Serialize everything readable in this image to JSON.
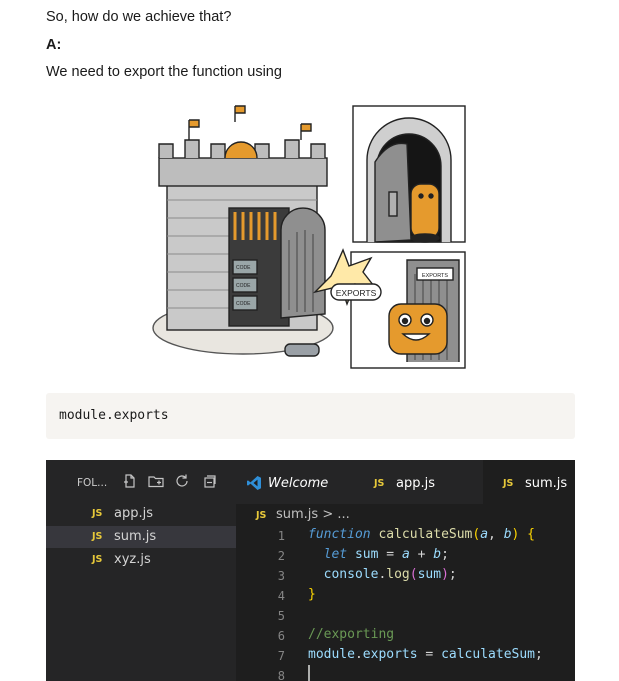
{
  "article": {
    "question": "So, how do we achieve that?",
    "answer_label": "A:",
    "explanation": "We need to export the function using"
  },
  "illustration": {
    "can_labels": [
      "CODE",
      "CODE",
      "CODE"
    ],
    "speech_bubble": "EXPORTS",
    "door_sign": "EXPORTS"
  },
  "code_block": {
    "text": "module.exports"
  },
  "editor": {
    "explorer": {
      "folder_label": "FOL...",
      "icons": [
        "new-file-icon",
        "new-folder-icon",
        "refresh-icon",
        "collapse-icon"
      ],
      "files": [
        {
          "badge": "JS",
          "name": "app.js",
          "active": false
        },
        {
          "badge": "JS",
          "name": "sum.js",
          "active": true
        },
        {
          "badge": "JS",
          "name": "xyz.js",
          "active": false
        }
      ]
    },
    "tabs": [
      {
        "label": "Welcome",
        "icon": "vscode-logo-icon"
      },
      {
        "badge": "JS",
        "label": "app.js"
      },
      {
        "badge": "JS",
        "label": "sum.js",
        "active": true
      }
    ],
    "breadcrumb": {
      "badge": "JS",
      "text": "sum.js > ..."
    },
    "line_numbers": [
      "1",
      "2",
      "3",
      "4",
      "5",
      "6",
      "7",
      "8"
    ],
    "code_lines": [
      [
        {
          "t": "function",
          "c": "kw"
        },
        {
          "t": " "
        },
        {
          "t": "calculateSum",
          "c": "fn"
        },
        {
          "t": "(",
          "c": "br1"
        },
        {
          "t": "a",
          "c": "pm"
        },
        {
          "t": ", "
        },
        {
          "t": "b",
          "c": "pm"
        },
        {
          "t": ")",
          "c": "br1"
        },
        {
          "t": " "
        },
        {
          "t": "{",
          "c": "br1"
        }
      ],
      [
        {
          "t": "  "
        },
        {
          "t": "let",
          "c": "kw"
        },
        {
          "t": " "
        },
        {
          "t": "sum",
          "c": "vr"
        },
        {
          "t": " = ",
          "c": "op"
        },
        {
          "t": "a",
          "c": "pm"
        },
        {
          "t": " + ",
          "c": "op"
        },
        {
          "t": "b",
          "c": "pm"
        },
        {
          "t": ";"
        }
      ],
      [
        {
          "t": "  "
        },
        {
          "t": "console",
          "c": "vr"
        },
        {
          "t": "."
        },
        {
          "t": "log",
          "c": "fn"
        },
        {
          "t": "(",
          "c": "br2"
        },
        {
          "t": "sum",
          "c": "vr"
        },
        {
          "t": ")",
          "c": "br2"
        },
        {
          "t": ";"
        }
      ],
      [
        {
          "t": "}",
          "c": "br1"
        }
      ],
      [],
      [
        {
          "t": "//exporting",
          "c": "cm"
        }
      ],
      [
        {
          "t": "module",
          "c": "vr"
        },
        {
          "t": "."
        },
        {
          "t": "exports",
          "c": "vr"
        },
        {
          "t": " = ",
          "c": "op"
        },
        {
          "t": "calculateSum",
          "c": "vr"
        },
        {
          "t": ";"
        }
      ]
    ]
  }
}
